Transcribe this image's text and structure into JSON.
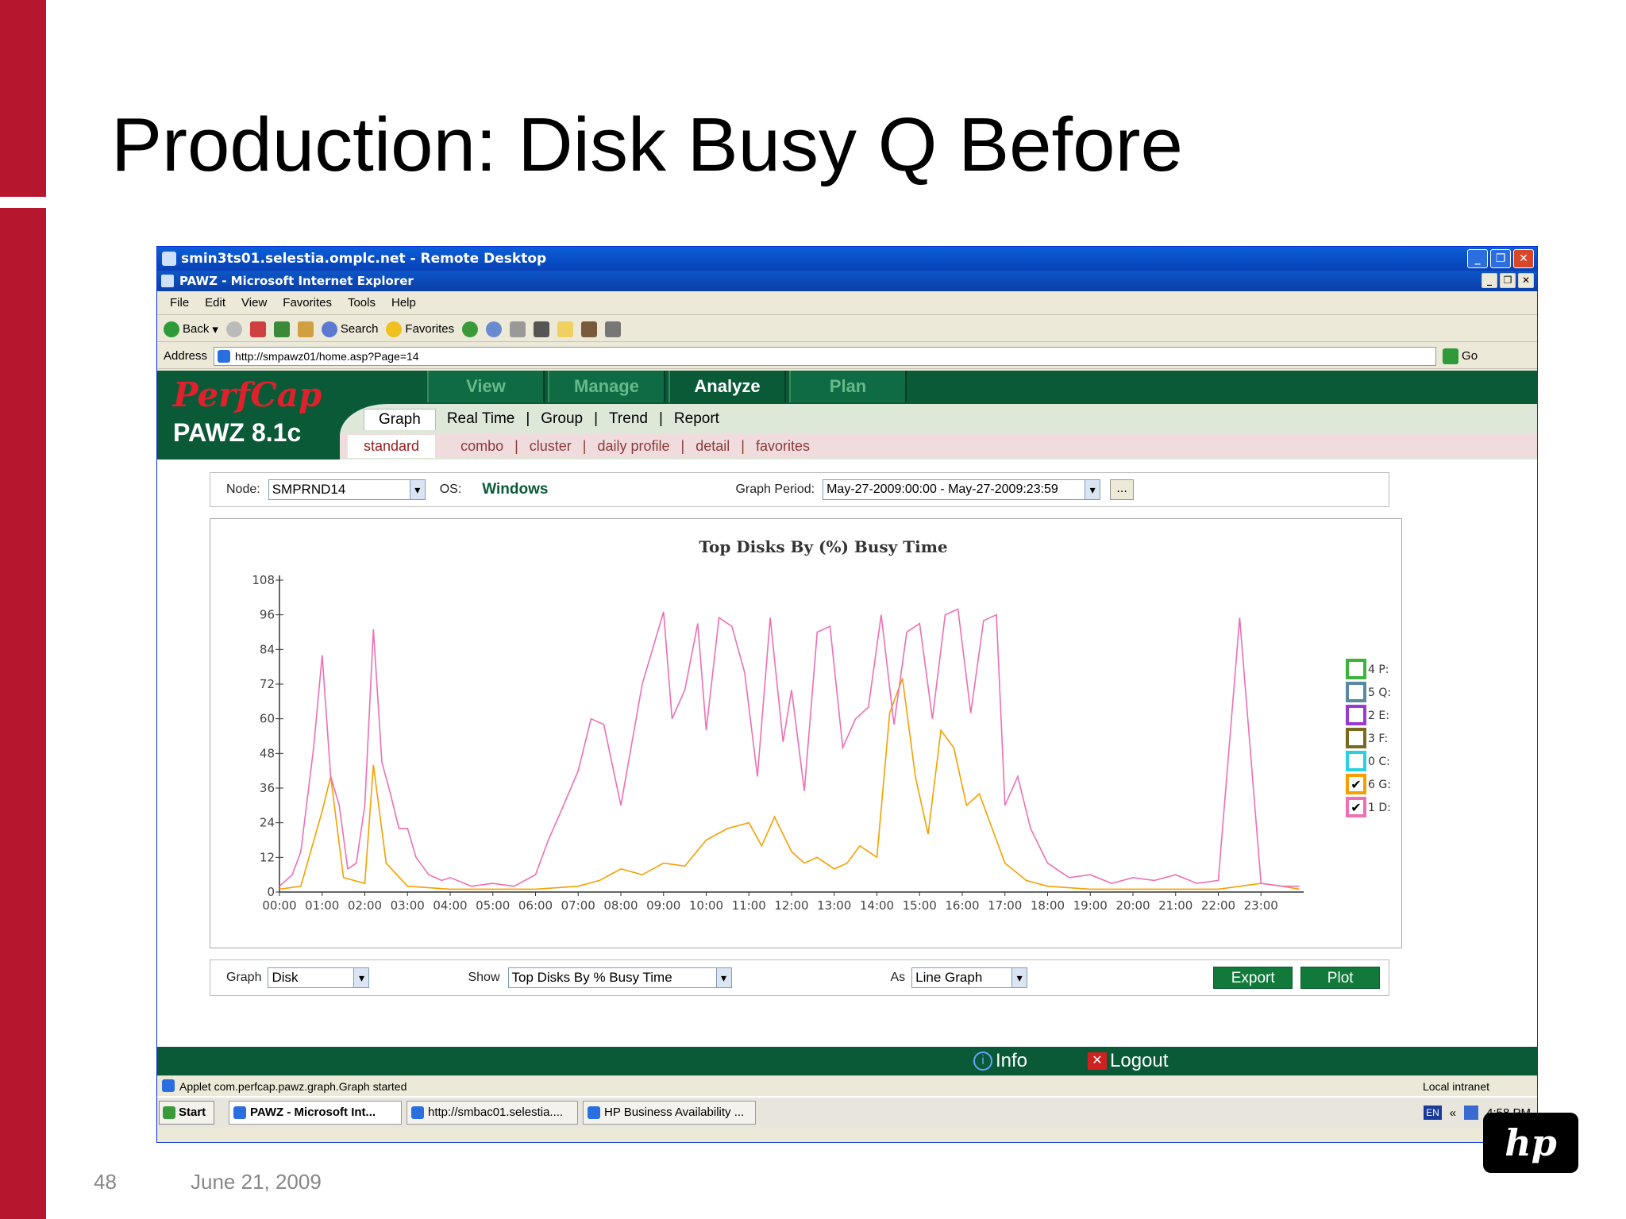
{
  "slide": {
    "title": "Production: Disk Busy Q Before",
    "number": "48",
    "date": "June 21, 2009",
    "logo_text": "hp"
  },
  "window": {
    "rdp_title": "smin3ts01.selestia.omplc.net - Remote Desktop",
    "ie_title": "PAWZ - Microsoft Internet Explorer"
  },
  "menu": [
    "File",
    "Edit",
    "View",
    "Favorites",
    "Tools",
    "Help"
  ],
  "toolbar": {
    "back": "Back",
    "search": "Search",
    "favorites": "Favorites"
  },
  "address": {
    "label": "Address",
    "url": "http://smpawz01/home.asp?Page=14",
    "go": "Go"
  },
  "pawz": {
    "brand": "PerfCap",
    "product": "PAWZ 8.1c",
    "main_tabs": [
      "View",
      "Manage",
      "Analyze",
      "Plan"
    ],
    "sub_tabs": [
      "Graph",
      "Real Time",
      "Group",
      "Trend",
      "Report"
    ],
    "sub_sub_tabs": [
      "standard",
      "combo",
      "cluster",
      "daily profile",
      "detail",
      "favorites"
    ]
  },
  "node_row": {
    "node_label": "Node:",
    "node_value": "SMPRND14",
    "os_label": "OS:",
    "os_value": "Windows",
    "period_label": "Graph Period:",
    "period_value": "May-27-2009:00:00 - May-27-2009:23:59",
    "period_btn": "..."
  },
  "controls": {
    "graph_label": "Graph",
    "graph_value": "Disk",
    "show_label": "Show",
    "show_value": "Top Disks By % Busy Time",
    "as_label": "As",
    "as_value": "Line Graph",
    "export": "Export",
    "plot": "Plot"
  },
  "footer": {
    "info": "Info",
    "logout": "Logout"
  },
  "status": {
    "text": "Applet com.perfcap.pawz.graph.Graph started",
    "zone": "Local intranet"
  },
  "taskbar": {
    "start": "Start",
    "tasks": [
      "PAWZ - Microsoft Int...",
      "http://smbac01.selestia....",
      "HP Business Availability ..."
    ],
    "lang": "EN",
    "time": "4:58 PM",
    "tray_arrows": "«"
  },
  "colors": {
    "pawz_green": "#0a5a38",
    "slide_red": "#b6172e",
    "series_1D": "#ee6fb5",
    "series_6G": "#f5a000"
  },
  "chart_data": {
    "type": "line",
    "title": "Top Disks By (%) Busy Time",
    "x_ticks": [
      "00:00",
      "01:00",
      "02:00",
      "03:00",
      "04:00",
      "05:00",
      "06:00",
      "07:00",
      "08:00",
      "09:00",
      "10:00",
      "11:00",
      "12:00",
      "13:00",
      "14:00",
      "15:00",
      "16:00",
      "17:00",
      "18:00",
      "19:00",
      "20:00",
      "21:00",
      "22:00",
      "23:00"
    ],
    "y_ticks": [
      0,
      12,
      24,
      36,
      48,
      60,
      72,
      84,
      96,
      108
    ],
    "ylim": [
      0,
      108
    ],
    "xlim": [
      0,
      24
    ],
    "legend_placement": "right",
    "legend": [
      {
        "label": "4 P:",
        "color": "#3cb43c",
        "checked": false
      },
      {
        "label": "5 Q:",
        "color": "#5a8aa0",
        "checked": false
      },
      {
        "label": "2 E:",
        "color": "#9a3ad0",
        "checked": false
      },
      {
        "label": "3 F:",
        "color": "#7a6a20",
        "checked": false
      },
      {
        "label": "0 C:",
        "color": "#28d0e0",
        "checked": false
      },
      {
        "label": "6 G:",
        "color": "#f5a000",
        "checked": true
      },
      {
        "label": "1 D:",
        "color": "#ee6fb5",
        "checked": true
      }
    ],
    "series": [
      {
        "name": "1 D:",
        "x": [
          0,
          0.3,
          0.5,
          0.8,
          1.0,
          1.2,
          1.4,
          1.6,
          1.8,
          2.0,
          2.2,
          2.4,
          2.6,
          2.8,
          3.0,
          3.2,
          3.5,
          3.8,
          4.0,
          4.5,
          5.0,
          5.5,
          6.0,
          6.3,
          6.6,
          7.0,
          7.3,
          7.6,
          8.0,
          8.5,
          9.0,
          9.2,
          9.5,
          9.8,
          10.0,
          10.3,
          10.6,
          10.9,
          11.2,
          11.5,
          11.8,
          12.0,
          12.3,
          12.6,
          12.9,
          13.2,
          13.5,
          13.8,
          14.1,
          14.4,
          14.7,
          15.0,
          15.3,
          15.6,
          15.9,
          16.2,
          16.5,
          16.8,
          17.0,
          17.3,
          17.6,
          18.0,
          18.5,
          19.0,
          19.5,
          20.0,
          20.5,
          21.0,
          21.5,
          22.0,
          22.5,
          23.0,
          23.5,
          23.9
        ],
        "y": [
          2,
          6,
          14,
          50,
          82,
          40,
          30,
          8,
          10,
          30,
          91,
          45,
          34,
          22,
          22,
          12,
          6,
          4,
          5,
          2,
          3,
          2,
          6,
          18,
          28,
          42,
          60,
          58,
          30,
          72,
          97,
          60,
          70,
          93,
          56,
          95,
          92,
          76,
          40,
          95,
          52,
          70,
          35,
          90,
          92,
          50,
          60,
          64,
          96,
          58,
          90,
          93,
          60,
          96,
          98,
          62,
          94,
          96,
          30,
          40,
          22,
          10,
          5,
          6,
          3,
          5,
          4,
          6,
          3,
          4,
          95,
          3,
          2,
          2
        ]
      },
      {
        "name": "6 G:",
        "x": [
          0,
          0.5,
          1.0,
          1.2,
          1.5,
          2.0,
          2.2,
          2.5,
          3.0,
          4.0,
          5.0,
          6.0,
          7.0,
          7.5,
          8.0,
          8.5,
          9.0,
          9.5,
          10.0,
          10.5,
          11.0,
          11.3,
          11.6,
          12.0,
          12.3,
          12.6,
          13.0,
          13.3,
          13.6,
          14.0,
          14.3,
          14.6,
          14.9,
          15.2,
          15.5,
          15.8,
          16.1,
          16.4,
          16.7,
          17.0,
          17.5,
          18.0,
          19.0,
          20.0,
          21.0,
          22.0,
          23.0,
          23.5,
          23.9
        ],
        "y": [
          1,
          2,
          28,
          40,
          5,
          3,
          44,
          10,
          2,
          1,
          1,
          1,
          2,
          4,
          8,
          6,
          10,
          9,
          18,
          22,
          24,
          16,
          26,
          14,
          10,
          12,
          8,
          10,
          16,
          12,
          62,
          74,
          40,
          20,
          56,
          50,
          30,
          34,
          22,
          10,
          4,
          2,
          1,
          1,
          1,
          1,
          3,
          2,
          1
        ]
      }
    ]
  }
}
